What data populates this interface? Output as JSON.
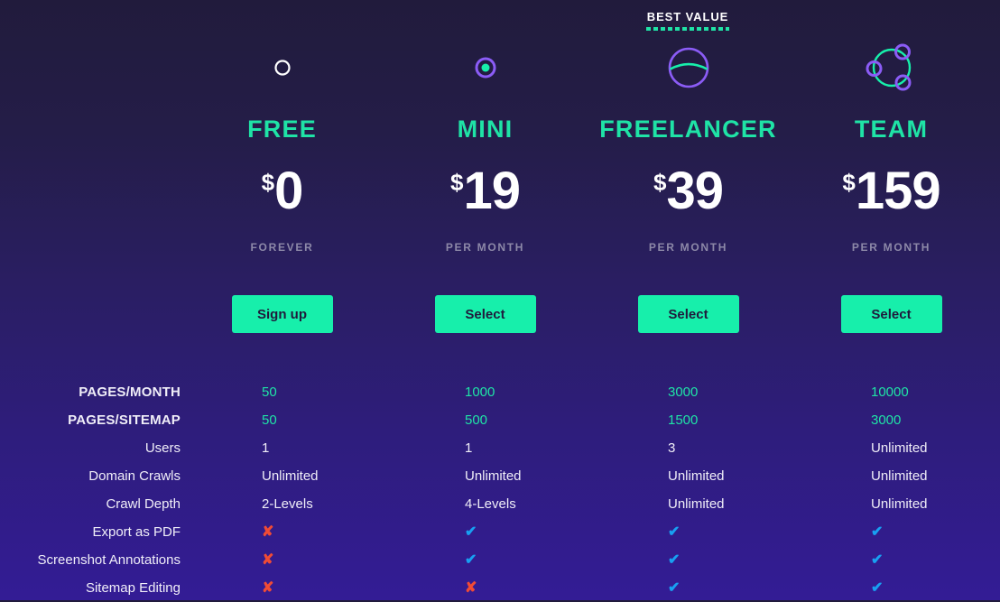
{
  "badge": {
    "label": "BEST VALUE"
  },
  "colors": {
    "accent_green": "#1fe3a6",
    "button_green": "#17efab",
    "check_blue": "#18a0f2",
    "cross_red": "#f04b35",
    "icon_purple": "#8b5cf6",
    "muted_text": "#8d89a8",
    "bg_top": "#211b3c",
    "bg_bottom": "#331c95"
  },
  "plans": [
    {
      "name": "FREE",
      "icon": "ring-outline-icon",
      "currency": "$",
      "price": "0",
      "period": "FOREVER",
      "cta": "Sign up"
    },
    {
      "name": "MINI",
      "icon": "ring-dot-icon",
      "currency": "$",
      "price": "19",
      "period": "PER MONTH",
      "cta": "Select"
    },
    {
      "name": "FREELANCER",
      "icon": "circle-arc-icon",
      "currency": "$",
      "price": "39",
      "period": "PER MONTH",
      "cta": "Select"
    },
    {
      "name": "TEAM",
      "icon": "network-nodes-icon",
      "currency": "$",
      "price": "159",
      "period": "PER MONTH",
      "cta": "Select"
    }
  ],
  "features": [
    {
      "label": "PAGES/MONTH",
      "style": "caps",
      "value_style": "accent",
      "values": [
        "50",
        "1000",
        "3000",
        "10000"
      ]
    },
    {
      "label": "PAGES/SITEMAP",
      "style": "caps",
      "value_style": "accent",
      "values": [
        "50",
        "500",
        "1500",
        "3000"
      ]
    },
    {
      "label": "Users",
      "style": "normal",
      "value_style": "plain",
      "values": [
        "1",
        "1",
        "3",
        "Unlimited"
      ]
    },
    {
      "label": "Domain Crawls",
      "style": "normal",
      "value_style": "plain",
      "values": [
        "Unlimited",
        "Unlimited",
        "Unlimited",
        "Unlimited"
      ]
    },
    {
      "label": "Crawl Depth",
      "style": "normal",
      "value_style": "plain",
      "values": [
        "2-Levels",
        "4-Levels",
        "Unlimited",
        "Unlimited"
      ]
    },
    {
      "label": "Export as PDF",
      "style": "normal",
      "value_style": "mark",
      "values": [
        "no",
        "yes",
        "yes",
        "yes"
      ]
    },
    {
      "label": "Screenshot Annotations",
      "style": "normal",
      "value_style": "mark",
      "values": [
        "no",
        "yes",
        "yes",
        "yes"
      ]
    },
    {
      "label": "Sitemap Editing",
      "style": "normal",
      "value_style": "mark",
      "values": [
        "no",
        "no",
        "yes",
        "yes"
      ]
    }
  ],
  "marks": {
    "yes": "✔",
    "no": "✘"
  }
}
